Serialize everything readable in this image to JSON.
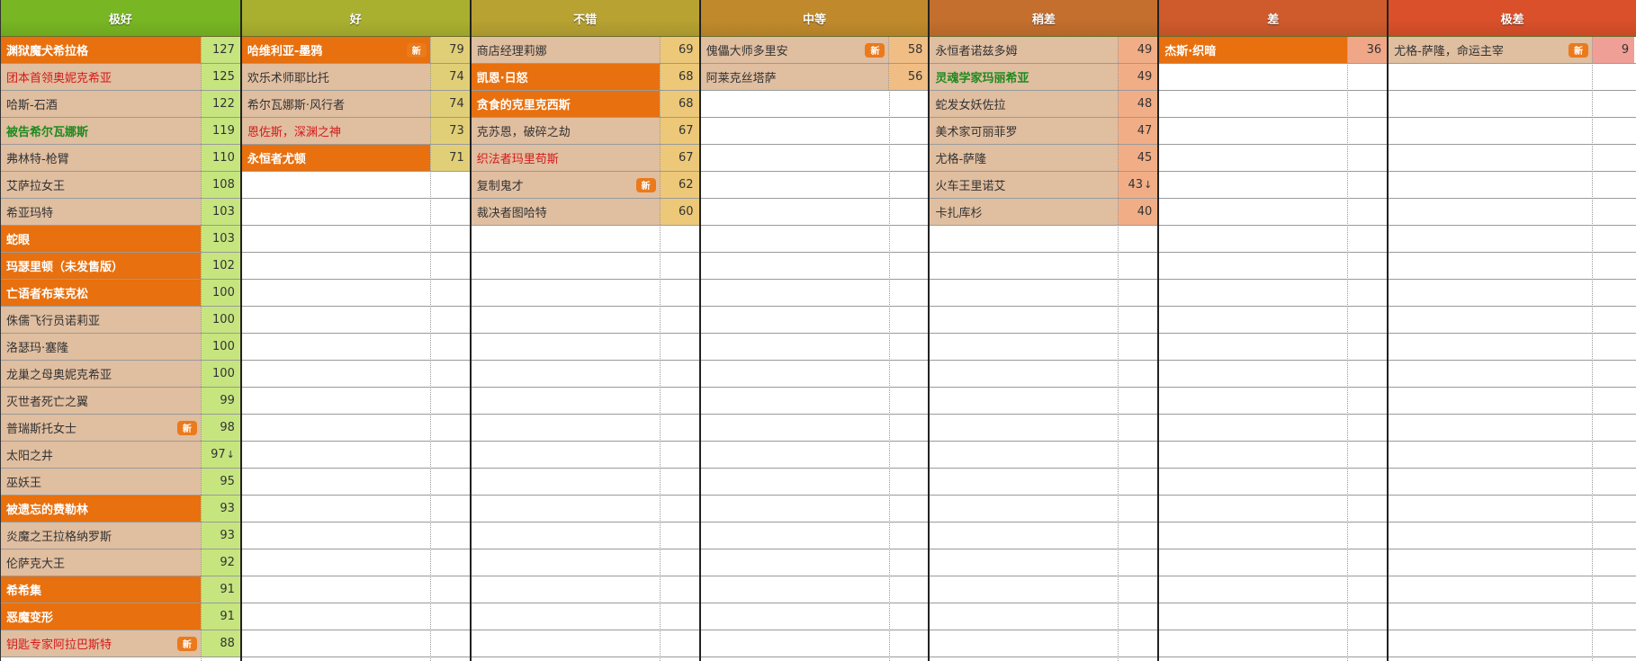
{
  "tiers": [
    {
      "label": "极好",
      "header_color": "#78b623",
      "score_color": "#c6e57f",
      "items": [
        {
          "name": "渊狱魔犬希拉格",
          "score": "127",
          "style": "highlight"
        },
        {
          "name": "团本首领奥妮克希亚",
          "score": "125",
          "style": "red"
        },
        {
          "name": "哈斯-石酒",
          "score": "122",
          "style": "normal"
        },
        {
          "name": "被告希尔瓦娜斯",
          "score": "119",
          "style": "green"
        },
        {
          "name": "弗林特-枪臂",
          "score": "110",
          "style": "normal"
        },
        {
          "name": "艾萨拉女王",
          "score": "108",
          "style": "normal"
        },
        {
          "name": "希亚玛特",
          "score": "103",
          "style": "normal"
        },
        {
          "name": "蛇眼",
          "score": "103",
          "style": "highlight"
        },
        {
          "name": "玛瑟里顿（未发售版）",
          "score": "102",
          "style": "highlight"
        },
        {
          "name": "亡语者布莱克松",
          "score": "100",
          "style": "highlight"
        },
        {
          "name": "侏儒飞行员诺莉亚",
          "score": "100",
          "style": "normal"
        },
        {
          "name": "洛瑟玛·塞隆",
          "score": "100",
          "style": "normal"
        },
        {
          "name": "龙巢之母奥妮克希亚",
          "score": "100",
          "style": "normal"
        },
        {
          "name": "灭世者死亡之翼",
          "score": "99",
          "style": "normal"
        },
        {
          "name": "普瑞斯托女士",
          "score": "98",
          "style": "normal",
          "badge": "新"
        },
        {
          "name": "太阳之井",
          "score": "97",
          "style": "normal",
          "trend": "↓"
        },
        {
          "name": "巫妖王",
          "score": "95",
          "style": "normal"
        },
        {
          "name": "被遗忘的费勒林",
          "score": "93",
          "style": "highlight"
        },
        {
          "name": "炎魔之王拉格纳罗斯",
          "score": "93",
          "style": "normal"
        },
        {
          "name": "伦萨克大王",
          "score": "92",
          "style": "normal"
        },
        {
          "name": "希希集",
          "score": "91",
          "style": "highlight"
        },
        {
          "name": "恶魔变形",
          "score": "91",
          "style": "highlight"
        },
        {
          "name": "钥匙专家阿拉巴斯特",
          "score": "88",
          "style": "red",
          "badge": "新"
        }
      ]
    },
    {
      "label": "好",
      "header_color": "#a9b02f",
      "score_color": "#e1cf78",
      "items": [
        {
          "name": "哈维利亚-墨鸦",
          "score": "79",
          "style": "highlight",
          "badge": "新"
        },
        {
          "name": "欢乐术师耶比托",
          "score": "74",
          "style": "normal"
        },
        {
          "name": "希尔瓦娜斯·风行者",
          "score": "74",
          "style": "normal"
        },
        {
          "name": "恩佐斯，深渊之神",
          "score": "73",
          "style": "red"
        },
        {
          "name": "永恒者尤顿",
          "score": "71",
          "style": "highlight"
        }
      ]
    },
    {
      "label": "不错",
      "header_color": "#b7a232",
      "score_color": "#ecc878",
      "items": [
        {
          "name": "商店经理莉娜",
          "score": "69",
          "style": "normal"
        },
        {
          "name": "凯恩·日怒",
          "score": "68",
          "style": "highlight"
        },
        {
          "name": "贪食的克里克西斯",
          "score": "68",
          "style": "highlight"
        },
        {
          "name": "克苏恩，破碎之劫",
          "score": "67",
          "style": "normal"
        },
        {
          "name": "织法者玛里苟斯",
          "score": "67",
          "style": "red"
        },
        {
          "name": "复制鬼才",
          "score": "62",
          "style": "normal",
          "badge": "新"
        },
        {
          "name": "裁决者图哈特",
          "score": "60",
          "style": "normal"
        }
      ]
    },
    {
      "label": "中等",
      "header_color": "#c08a2c",
      "score_color": "#f0be84",
      "items": [
        {
          "name": "傀儡大师多里安",
          "score": "58",
          "style": "normal",
          "badge": "新"
        },
        {
          "name": "阿莱克丝塔萨",
          "score": "56",
          "style": "normal"
        }
      ]
    },
    {
      "label": "稍差",
      "header_color": "#c46f2e",
      "score_color": "#f1ae86",
      "items": [
        {
          "name": "永恒者诺兹多姆",
          "score": "49",
          "style": "normal"
        },
        {
          "name": "灵魂学家玛丽希亚",
          "score": "49",
          "style": "green"
        },
        {
          "name": "蛇发女妖佐拉",
          "score": "48",
          "style": "normal"
        },
        {
          "name": "美术家可丽菲罗",
          "score": "47",
          "style": "normal"
        },
        {
          "name": "尤格-萨隆",
          "score": "45",
          "style": "normal"
        },
        {
          "name": "火车王里诺艾",
          "score": "43",
          "style": "normal",
          "trend": "↓"
        },
        {
          "name": "卡扎库杉",
          "score": "40",
          "style": "normal"
        }
      ]
    },
    {
      "label": "差",
      "header_color": "#cf5a2c",
      "score_color": "#f0a788",
      "items": [
        {
          "name": "杰斯·织暗",
          "score": "36",
          "style": "highlight"
        }
      ]
    },
    {
      "label": "极差",
      "header_color": "#d9502a",
      "score_color": "#ef9f96",
      "items": [
        {
          "name": "尤格-萨隆，命运主宰",
          "score": "9",
          "style": "normal",
          "badge": "新"
        }
      ]
    }
  ]
}
